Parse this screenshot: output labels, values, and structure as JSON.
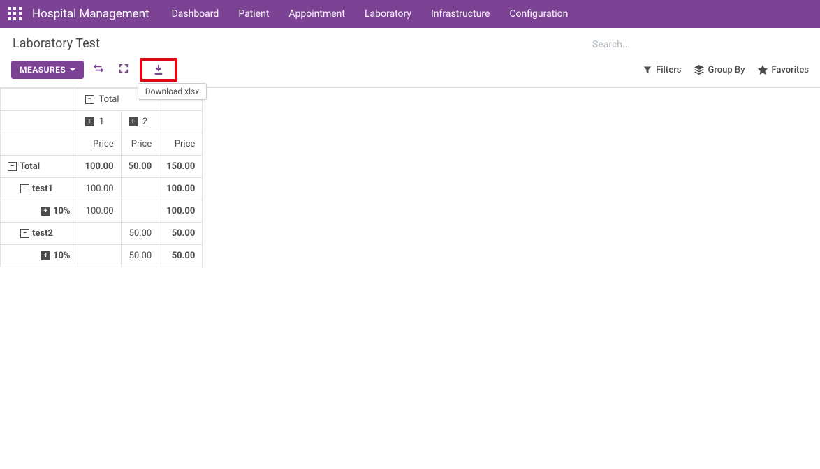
{
  "nav": {
    "brand": "Hospital Management",
    "links": [
      "Dashboard",
      "Patient",
      "Appointment",
      "Laboratory",
      "Infrastructure",
      "Configuration"
    ]
  },
  "page": {
    "title": "Laboratory Test",
    "measures_btn": "MEASURES",
    "download_tooltip": "Download xlsx"
  },
  "search": {
    "placeholder": "Search...",
    "filters": "Filters",
    "group_by": "Group By",
    "favorites": "Favorites"
  },
  "pivot": {
    "col_headers": {
      "total": "Total",
      "cols": [
        "1",
        "2"
      ],
      "measure": "Price"
    },
    "rows": [
      {
        "label": "Total",
        "indent": 0,
        "toggle": "minus",
        "vals": [
          "100.00",
          "50.00",
          "150.00"
        ],
        "bold": true
      },
      {
        "label": "test1",
        "indent": 1,
        "toggle": "minus",
        "vals": [
          "100.00",
          "",
          "100.00"
        ],
        "bold_last": true
      },
      {
        "label": "10%",
        "indent": 2,
        "toggle": "plus",
        "vals": [
          "100.00",
          "",
          "100.00"
        ],
        "bold_last": true
      },
      {
        "label": "test2",
        "indent": 1,
        "toggle": "minus",
        "vals": [
          "",
          "50.00",
          "50.00"
        ],
        "bold_last": true
      },
      {
        "label": "10%",
        "indent": 2,
        "toggle": "plus",
        "vals": [
          "",
          "50.00",
          "50.00"
        ],
        "bold_last": true
      }
    ]
  }
}
